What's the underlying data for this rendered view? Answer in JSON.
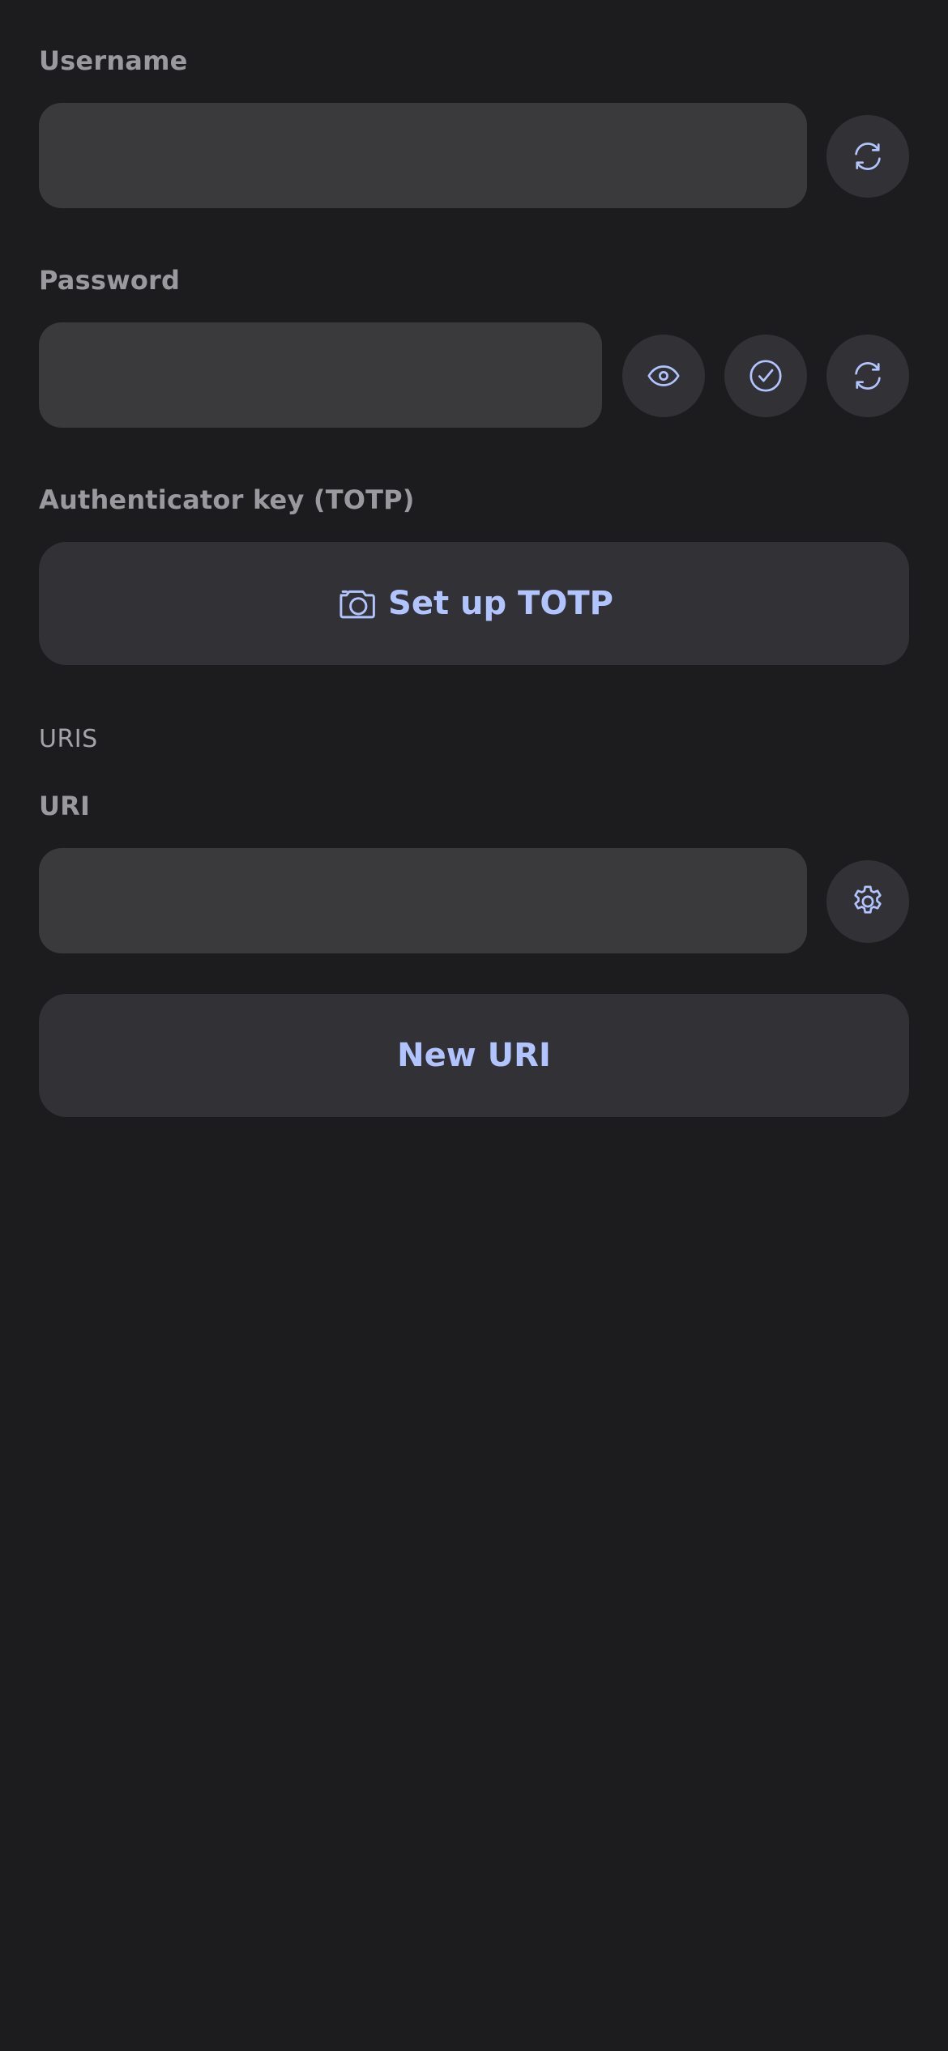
{
  "login": {
    "username": {
      "label": "Username",
      "value": "",
      "placeholder": ""
    },
    "password": {
      "label": "Password",
      "value": "",
      "placeholder": ""
    },
    "totp": {
      "label": "Authenticator key (TOTP)",
      "setup_button_label": "Set up TOTP"
    }
  },
  "uris": {
    "section_title": "URIS",
    "uri_label": "URI",
    "uri_value": "",
    "uri_placeholder": "",
    "new_uri_button_label": "New URI"
  },
  "icons": {
    "username_generate": "refresh-icon",
    "password_visibility": "eye-icon",
    "password_check": "check-circle-icon",
    "password_generate": "refresh-icon",
    "totp_camera": "camera-icon",
    "uri_options": "gear-icon"
  },
  "colors": {
    "background": "#1c1c1e",
    "field_background": "#3a3a3c",
    "button_background": "#323236",
    "accent": "#b2c4ff",
    "label": "#9a9a9e"
  }
}
